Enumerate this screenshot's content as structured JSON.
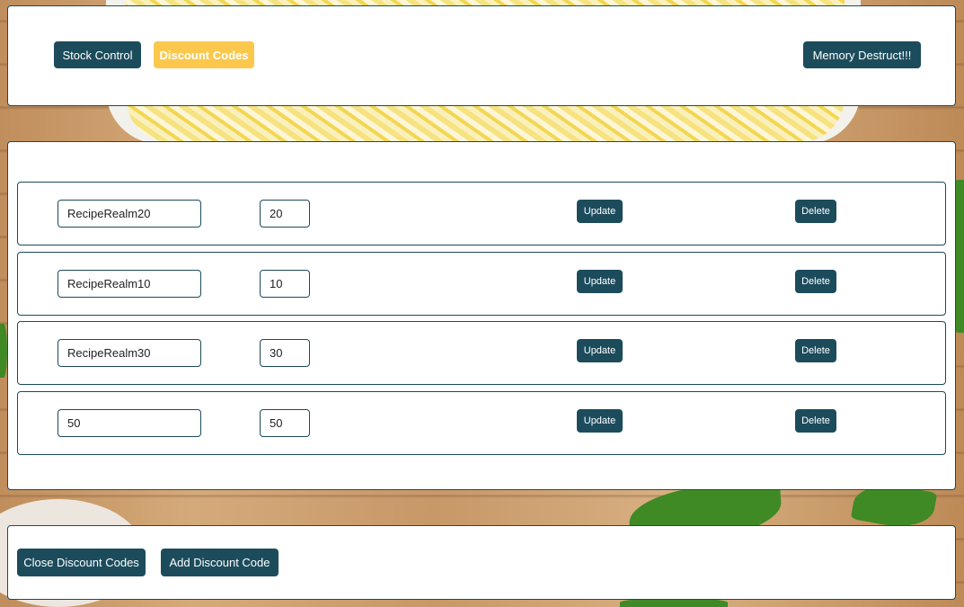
{
  "colors": {
    "primary": "#1c4c5c",
    "active_tab": "#fbc84d",
    "panel_border": "#1c4a5a",
    "panel_background": "#ffffff"
  },
  "nav": {
    "stock_control_label": "Stock Control",
    "discount_codes_label": "Discount Codes",
    "memory_destruct_label": "Memory Destruct!!!",
    "active_tab": "Discount Codes"
  },
  "discount_codes": [
    {
      "code": "RecipeRealm20",
      "percent": "20",
      "update_label": "Update",
      "delete_label": "Delete"
    },
    {
      "code": "RecipeRealm10",
      "percent": "10",
      "update_label": "Update",
      "delete_label": "Delete"
    },
    {
      "code": "RecipeRealm30",
      "percent": "30",
      "update_label": "Update",
      "delete_label": "Delete"
    },
    {
      "code": "50",
      "percent": "50",
      "update_label": "Update",
      "delete_label": "Delete"
    }
  ],
  "footer": {
    "close_label": "Close Discount Codes",
    "add_label": "Add Discount Code"
  }
}
